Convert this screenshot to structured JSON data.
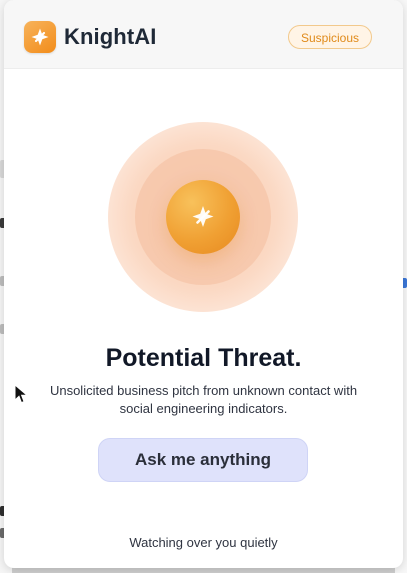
{
  "app": {
    "brand_name": "KnightAI",
    "status_badge": "Suspicious"
  },
  "threat": {
    "title": "Potential Threat.",
    "description": "Unsolicited business pitch from unknown contact with social engineering indicators."
  },
  "actions": {
    "ask_label": "Ask me anything"
  },
  "footer": {
    "text": "Watching over you quietly"
  },
  "icons": {
    "logo": "knight-spark-icon",
    "threat": "knight-spark-icon",
    "cursor": "mouse-cursor-icon"
  },
  "colors": {
    "brand_orange": "#f28c1a",
    "badge_text": "#e08a1a",
    "badge_bg": "#fff4e6",
    "button_bg": "#dfe2fb"
  }
}
